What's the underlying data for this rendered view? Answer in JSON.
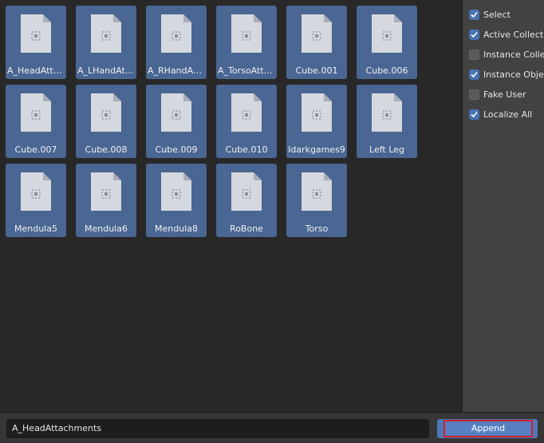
{
  "browser": {
    "items": [
      {
        "name": "A_HeadAttac...",
        "icon": "file-object-icon"
      },
      {
        "name": "A_LHandAtta...",
        "icon": "file-object-icon"
      },
      {
        "name": "A_RHandAtta...",
        "icon": "file-object-icon"
      },
      {
        "name": "A_TorsoAttac...",
        "icon": "file-object-icon"
      },
      {
        "name": "Cube.001",
        "icon": "file-object-icon"
      },
      {
        "name": "Cube.006",
        "icon": "file-object-icon"
      },
      {
        "name": "Cube.007",
        "icon": "file-object-icon"
      },
      {
        "name": "Cube.008",
        "icon": "file-object-icon"
      },
      {
        "name": "Cube.009",
        "icon": "file-object-icon"
      },
      {
        "name": "Cube.010",
        "icon": "file-object-icon"
      },
      {
        "name": "Idarkgames9",
        "icon": "file-object-icon"
      },
      {
        "name": "Left Leg",
        "icon": "file-object-icon"
      },
      {
        "name": "Mendula5",
        "icon": "file-object-icon"
      },
      {
        "name": "Mendula6",
        "icon": "file-object-icon"
      },
      {
        "name": "Mendula8",
        "icon": "file-object-icon"
      },
      {
        "name": "RoBone",
        "icon": "file-object-icon"
      },
      {
        "name": "Torso",
        "icon": "file-object-icon"
      }
    ]
  },
  "options": {
    "items": [
      {
        "label": "Select",
        "checked": true
      },
      {
        "label": "Active Collection",
        "checked": true
      },
      {
        "label": "Instance Collections",
        "checked": false
      },
      {
        "label": "Instance Object Data",
        "checked": true
      },
      {
        "label": "Fake User",
        "checked": false
      },
      {
        "label": "Localize All",
        "checked": true
      }
    ]
  },
  "footer": {
    "filename_value": "A_HeadAttachments",
    "append_label": "Append"
  },
  "colors": {
    "tile_selected": "#4a6693",
    "checkbox_on": "#4772b3",
    "append_button": "#5680c2",
    "highlight_border": "#d0202a"
  }
}
